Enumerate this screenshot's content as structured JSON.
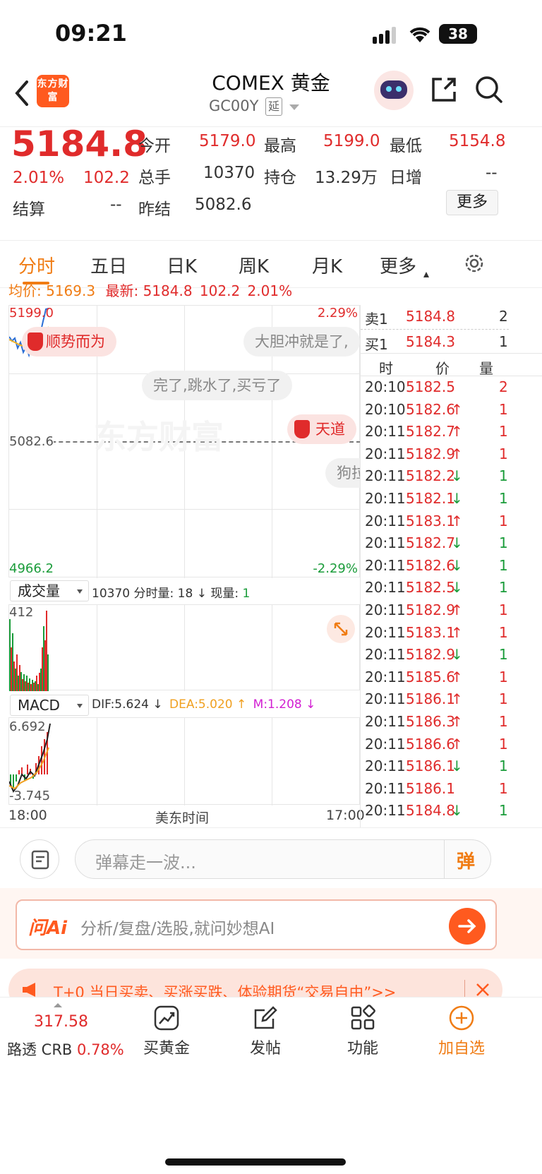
{
  "status": {
    "time": "09:21",
    "battery": "38"
  },
  "header": {
    "title": "COMEX 黄金",
    "code": "GC00Y",
    "delay_badge": "延",
    "logo_text": "东方财富"
  },
  "quote": {
    "price": "5184.8",
    "change_pct": "2.01%",
    "change": "102.2",
    "settle_label": "结算",
    "settle_value": "--",
    "open_label": "今开",
    "open_value": "5179.0",
    "high_label": "最高",
    "high_value": "5199.0",
    "low_label": "最低",
    "low_value": "5154.8",
    "volume_label": "总手",
    "volume_value": "10370",
    "oi_label": "持仓",
    "oi_value": "13.29万",
    "daily_inc_label": "日增",
    "daily_inc_value": "--",
    "prev_settle_label": "昨结",
    "prev_settle_value": "5082.6",
    "more_button": "更多"
  },
  "tabs": [
    "分时",
    "五日",
    "日K",
    "周K",
    "月K",
    "更多"
  ],
  "info_line": {
    "avg_label": "均价:",
    "avg_value": "5169.3",
    "latest_label": "最新:",
    "latest_value": "5184.8",
    "change": "102.2",
    "pct": "2.01%"
  },
  "chart": {
    "y_top": "5199.0",
    "y_top_pct": "2.29%",
    "y_mid": "5082.6",
    "y_bottom": "4966.2",
    "y_bottom_pct": "-2.29%",
    "watermark": "东方财富",
    "danmaku": [
      "顺势而为",
      "大胆冲就是了,",
      "完了,跳水了,买亏了",
      "天道",
      "狗拉"
    ],
    "volume_selector": "成交量",
    "volume_total": "10370",
    "volume_min_label": "分时量:",
    "volume_min_value": "18",
    "volume_now_label": "现量:",
    "volume_now_value": "1",
    "volume_max": "412",
    "macd_selector": "MACD",
    "dif": "DIF:5.624",
    "dea": "DEA:5.020",
    "m": "M:1.208",
    "macd_top": "6.692",
    "macd_bottom": "-3.745",
    "time_start": "18:00",
    "time_mid": "美东时间",
    "time_end": "17:00"
  },
  "orderbook": {
    "sell_label": "卖1",
    "sell_price": "5184.8",
    "sell_qty": "2",
    "buy_label": "买1",
    "buy_price": "5184.3",
    "buy_qty": "1",
    "col_time": "时",
    "col_price": "价",
    "col_qty": "量"
  },
  "ticks": [
    {
      "t": "20:10",
      "p": "5182.5",
      "d": "",
      "q": "2",
      "c": "red"
    },
    {
      "t": "20:10",
      "p": "5182.6",
      "d": "↑",
      "q": "1",
      "c": "red"
    },
    {
      "t": "20:11",
      "p": "5182.7",
      "d": "↑",
      "q": "1",
      "c": "red"
    },
    {
      "t": "20:11",
      "p": "5182.9",
      "d": "↑",
      "q": "1",
      "c": "red"
    },
    {
      "t": "20:11",
      "p": "5182.2",
      "d": "↓",
      "q": "1",
      "c": "green"
    },
    {
      "t": "20:11",
      "p": "5182.1",
      "d": "↓",
      "q": "1",
      "c": "green"
    },
    {
      "t": "20:11",
      "p": "5183.1",
      "d": "↑",
      "q": "1",
      "c": "red"
    },
    {
      "t": "20:11",
      "p": "5182.7",
      "d": "↓",
      "q": "1",
      "c": "green"
    },
    {
      "t": "20:11",
      "p": "5182.6",
      "d": "↓",
      "q": "1",
      "c": "green"
    },
    {
      "t": "20:11",
      "p": "5182.5",
      "d": "↓",
      "q": "1",
      "c": "green"
    },
    {
      "t": "20:11",
      "p": "5182.9",
      "d": "↑",
      "q": "1",
      "c": "red"
    },
    {
      "t": "20:11",
      "p": "5183.1",
      "d": "↑",
      "q": "1",
      "c": "red"
    },
    {
      "t": "20:11",
      "p": "5182.9",
      "d": "↓",
      "q": "1",
      "c": "green"
    },
    {
      "t": "20:11",
      "p": "5185.6",
      "d": "↑",
      "q": "1",
      "c": "red"
    },
    {
      "t": "20:11",
      "p": "5186.1",
      "d": "↑",
      "q": "1",
      "c": "red"
    },
    {
      "t": "20:11",
      "p": "5186.3",
      "d": "↑",
      "q": "1",
      "c": "red"
    },
    {
      "t": "20:11",
      "p": "5186.6",
      "d": "↑",
      "q": "1",
      "c": "red"
    },
    {
      "t": "20:11",
      "p": "5186.1",
      "d": "↓",
      "q": "1",
      "c": "green"
    },
    {
      "t": "20:11",
      "p": "5186.1",
      "d": "",
      "q": "1",
      "c": "red"
    },
    {
      "t": "20:11",
      "p": "5184.8",
      "d": "↓",
      "q": "1",
      "c": "green"
    }
  ],
  "comment": {
    "placeholder": "弹幕走一波...",
    "danmu_btn": "弹"
  },
  "ai": {
    "brand": "问Ai",
    "placeholder": "分析/复盘/选股,就问妙想AI"
  },
  "promo": {
    "text": "T+0 当日买卖、买涨买跌、体验期货“交易自由”>>"
  },
  "bottom": {
    "crb_value": "317.58",
    "crb_label": "路透 CRB",
    "crb_pct": "0.78%",
    "items": [
      "买黄金",
      "发帖",
      "功能",
      "加自选"
    ]
  },
  "colors": {
    "red": "#e02b2b",
    "green": "#1a9c3a",
    "orange": "#f07c14",
    "accent": "#ff5a1f"
  }
}
